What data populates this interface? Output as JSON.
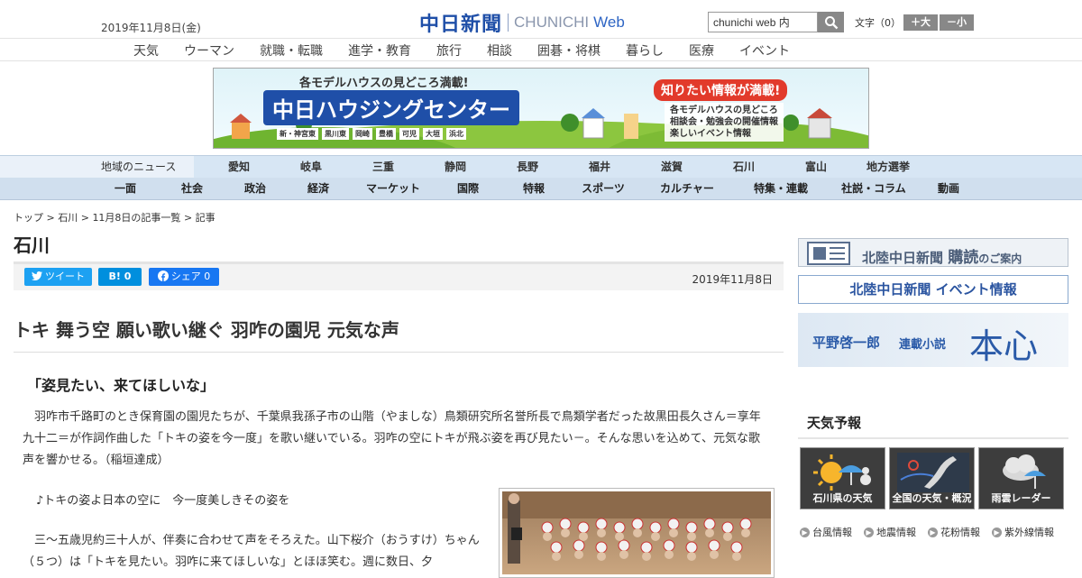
{
  "header": {
    "date": "2019年11月8日(金)",
    "logo_ja": "中日新聞",
    "logo_en": "CHUNICHI",
    "logo_web": "Web",
    "search_value": "chunichi web 内",
    "fontsize_label": "文字（0）",
    "font_larger": "＋大",
    "font_smaller": "－小"
  },
  "nav_top": [
    "天気",
    "ウーマン",
    "就職・転職",
    "進学・教育",
    "旅行",
    "相談",
    "囲碁・将棋",
    "暮らし",
    "医療",
    "イベント"
  ],
  "banner": {
    "top": "各モデルハウスの見どころ満載!",
    "main": "中日ハウジングセンター",
    "areas": [
      "新・神宮東",
      "黒川東",
      "岡崎",
      "豊橋",
      "可児",
      "大垣",
      "浜北"
    ],
    "right_title": "知りたい情報が満載!",
    "right_items": [
      "各モデルハウスの見どころ",
      "相談会・勉強会の開催情報",
      "楽しいイベント情報"
    ]
  },
  "nav_region": {
    "label": "地域のニュース",
    "items": [
      "愛知",
      "岐阜",
      "三重",
      "静岡",
      "長野",
      "福井",
      "滋賀",
      "石川",
      "富山",
      "地方選挙"
    ]
  },
  "nav_cat": [
    "一面",
    "社会",
    "政治",
    "経済",
    "マーケット",
    "国際",
    "特報",
    "スポーツ",
    "カルチャー",
    "特集・連載",
    "社説・コラム",
    "動画"
  ],
  "breadcrumb": {
    "top": "トップ",
    "region": "石川",
    "list": "11月8日の記事一覧",
    "current": "記事",
    "sep": ">"
  },
  "section_title": "石川",
  "share": {
    "tweet": "ツイート",
    "hatena": "B! 0",
    "facebook": "シェア 0",
    "date": "2019年11月8日"
  },
  "article": {
    "headline": "トキ 舞う空 願い歌い継ぐ 羽咋の園児 元気な声",
    "subhead": "「姿見たい、来てほしいな」",
    "lead": "羽咋市千路町のとき保育園の園児たちが、千葉県我孫子市の山階（やましな）鳥類研究所名誉所長で鳥類学者だった故黒田長久さん＝享年九十二＝が作詞作曲した「トキの姿を今一度」を歌い継いでいる。羽咋の空にトキが飛ぶ姿を再び見たい－。そんな思いを込めて、元気な歌声を響かせる。（稲垣達成）",
    "lyric": "♪トキの姿よ日本の空に　今一度美しきその姿を",
    "body": "三～五歳児約三十人が、伴奏に合わせて声をそろえた。山下桜介（おうすけ）ちゃん（５つ）は「トキを見たい。羽咋に来てほしいな」とほほ笑む。週に数日、夕"
  },
  "sidebar": {
    "subscribe_title": "北陸中日新聞",
    "subscribe_emph": "購",
    "subscribe_rest": "読",
    "subscribe_suffix": "のご案内",
    "event": "北陸中日新聞 イベント情報",
    "novel_author": "平野啓一郎",
    "novel_label": "連載小説",
    "novel_title": "本心",
    "weather_title": "天気予報",
    "weather_tiles": [
      "石川県の天気",
      "全国の天気・概況",
      "雨雲レーダー"
    ],
    "weather_links": [
      "台風情報",
      "地震情報",
      "花粉情報",
      "紫外線情報"
    ]
  },
  "colors": {
    "brand": "#1f4fa8",
    "twitter": "#1da1f2",
    "hatena": "#008fde",
    "facebook": "#1877f2"
  }
}
